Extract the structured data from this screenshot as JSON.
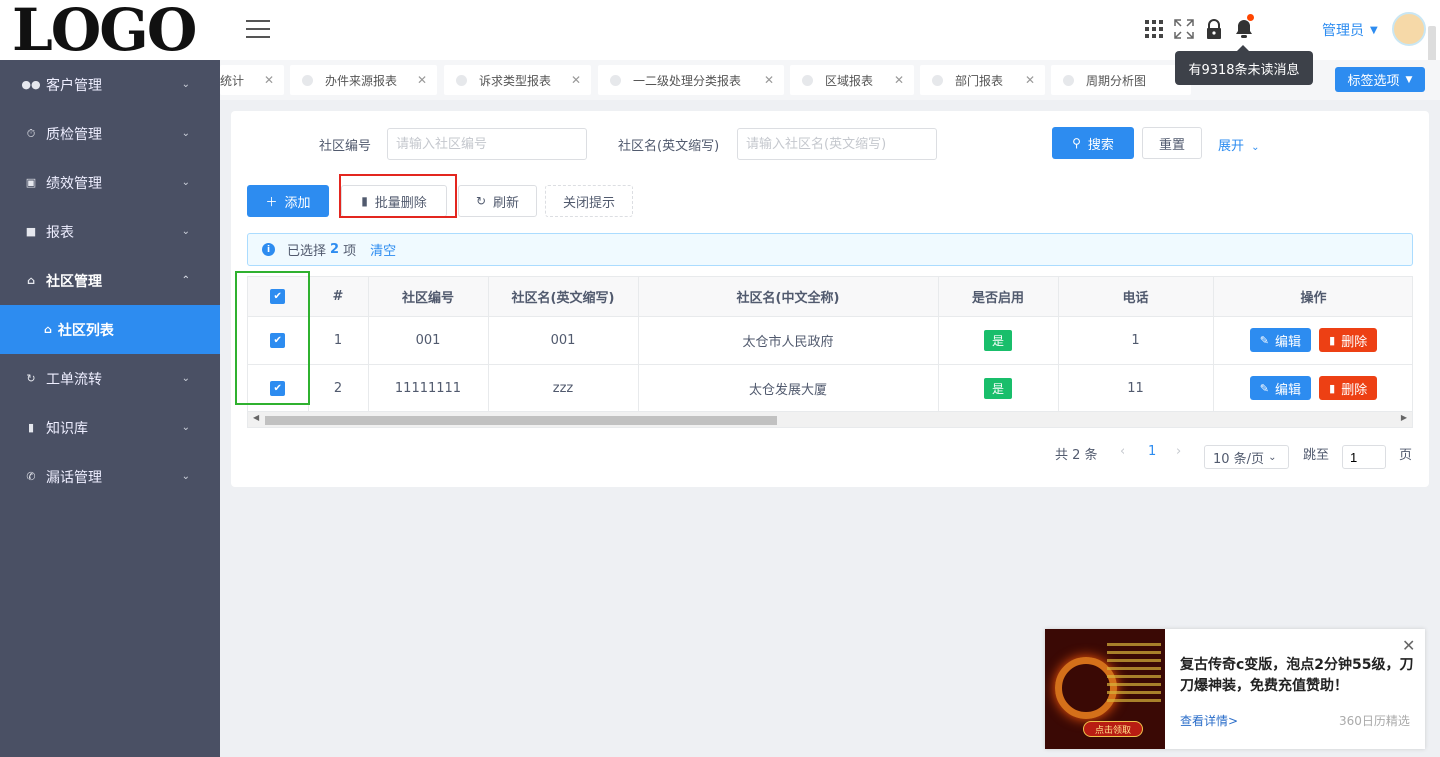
{
  "logo": "LOGO",
  "sidebar": {
    "items": [
      {
        "label": "客户管理",
        "icon": "users-icon"
      },
      {
        "label": "质检管理",
        "icon": "clock-icon"
      },
      {
        "label": "绩效管理",
        "icon": "chart-icon"
      },
      {
        "label": "报表",
        "icon": "briefcase-icon"
      },
      {
        "label": "社区管理",
        "icon": "home-icon"
      },
      {
        "label": "社区列表",
        "icon": "home-icon"
      },
      {
        "label": "工单流转",
        "icon": "refresh-icon"
      },
      {
        "label": "知识库",
        "icon": "book-icon"
      },
      {
        "label": "漏话管理",
        "icon": "phone-icon"
      }
    ]
  },
  "header": {
    "user": "管理员",
    "tooltip": "有9318条未读消息"
  },
  "tabs": [
    {
      "label": "统计"
    },
    {
      "label": "办件来源报表"
    },
    {
      "label": "诉求类型报表"
    },
    {
      "label": "一二级处理分类报表"
    },
    {
      "label": "区域报表"
    },
    {
      "label": "部门报表"
    },
    {
      "label": "周期分析图"
    }
  ],
  "tag_options": "标签选项",
  "search": {
    "code_label": "社区编号",
    "code_placeholder": "请输入社区编号",
    "name_label": "社区名(英文缩写)",
    "name_placeholder": "请输入社区名(英文缩写)",
    "search_btn": "搜索",
    "reset_btn": "重置",
    "expand": "展开"
  },
  "toolbar": {
    "add": "添加",
    "batch_delete": "批量删除",
    "refresh": "刷新",
    "close_tip": "关闭提示"
  },
  "alert": {
    "prefix": "已选择",
    "count": "2",
    "suffix": "项",
    "clear": "清空"
  },
  "table": {
    "headers": [
      "#",
      "社区编号",
      "社区名(英文缩写)",
      "社区名(中文全称)",
      "是否启用",
      "电话",
      "操作"
    ],
    "rows": [
      {
        "index": "1",
        "code": "001",
        "abbr": "001",
        "full": "太仓市人民政府",
        "enabled": "是",
        "phone": "1"
      },
      {
        "index": "2",
        "code": "11111111",
        "abbr": "zzz",
        "full": "太仓发展大厦",
        "enabled": "是",
        "phone": "11"
      }
    ],
    "edit": "编辑",
    "delete": "删除"
  },
  "pagination": {
    "total": "共 2 条",
    "current": "1",
    "page_size": "10 条/页",
    "jump_label": "跳至",
    "jump_value": "1",
    "page_unit": "页"
  },
  "ad": {
    "title": "复古传奇c变版，泡点2分钟55级，刀刀爆神装，免费充值赞助！",
    "link": "查看详情>",
    "source": "360日历精选",
    "cta": "点击领取"
  },
  "colors": {
    "primary": "#2d8cf0",
    "success": "#19be6b",
    "danger": "#ed4014",
    "sidebar": "#4a5064"
  }
}
